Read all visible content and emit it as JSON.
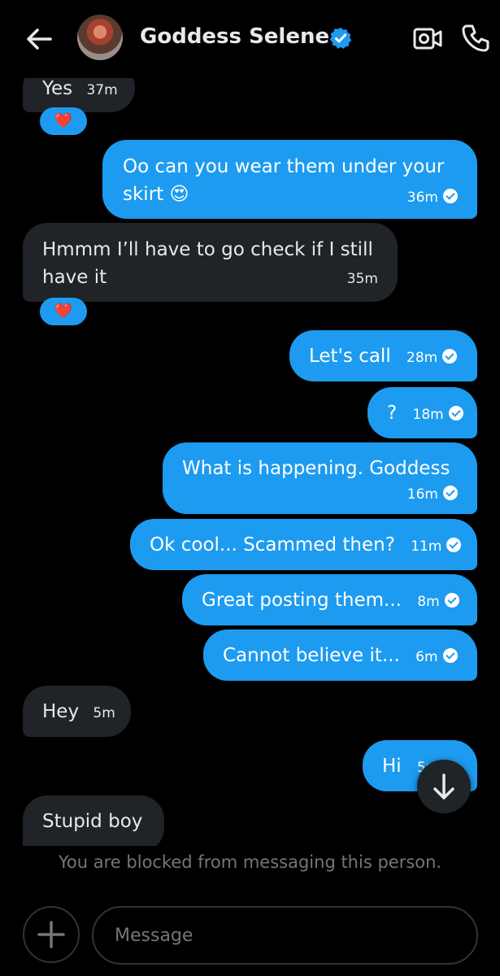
{
  "header": {
    "title": "Goddess Selene",
    "back_icon": "arrow-left-icon",
    "verified_icon": "verified-badge-icon",
    "video_icon": "video-camera-icon",
    "call_icon": "phone-icon"
  },
  "messages": [
    {
      "side": "in",
      "text": "Yes",
      "time": "37m",
      "reaction": "❤️"
    },
    {
      "side": "out",
      "text_line1": "Oo can you wear them under your",
      "text_line2": "skirt 😍",
      "time": "36m"
    },
    {
      "side": "in",
      "text_line1": "Hmmm I’ll have to go check if I still",
      "text_line2": "have it",
      "time": "35m",
      "reaction": "❤️"
    },
    {
      "side": "out",
      "text": "Let's call",
      "time": "28m"
    },
    {
      "side": "out",
      "text": "?",
      "time": "18m"
    },
    {
      "side": "out",
      "text": "What is happening. Goddess",
      "time": "16m"
    },
    {
      "side": "out",
      "text": "Ok cool... Scammed then?",
      "time": "11m"
    },
    {
      "side": "out",
      "text": "Great posting them...",
      "time": "8m"
    },
    {
      "side": "out",
      "text": "Cannot believe it...",
      "time": "6m"
    },
    {
      "side": "in",
      "text": "Hey",
      "time": "5m"
    },
    {
      "side": "out",
      "text": "Hi",
      "time": "5m"
    },
    {
      "side": "in",
      "text": "Stupid boy",
      "time": ""
    }
  ],
  "footer": {
    "blocked_notice": "You are blocked from messaging this person.",
    "input_placeholder": "Message",
    "add_icon": "plus-icon",
    "scroll_icon": "arrow-down-icon"
  },
  "colors": {
    "background": "#000000",
    "outgoing_bubble": "#1d9bf0",
    "incoming_bubble": "#202327",
    "muted_text": "#71767b"
  }
}
